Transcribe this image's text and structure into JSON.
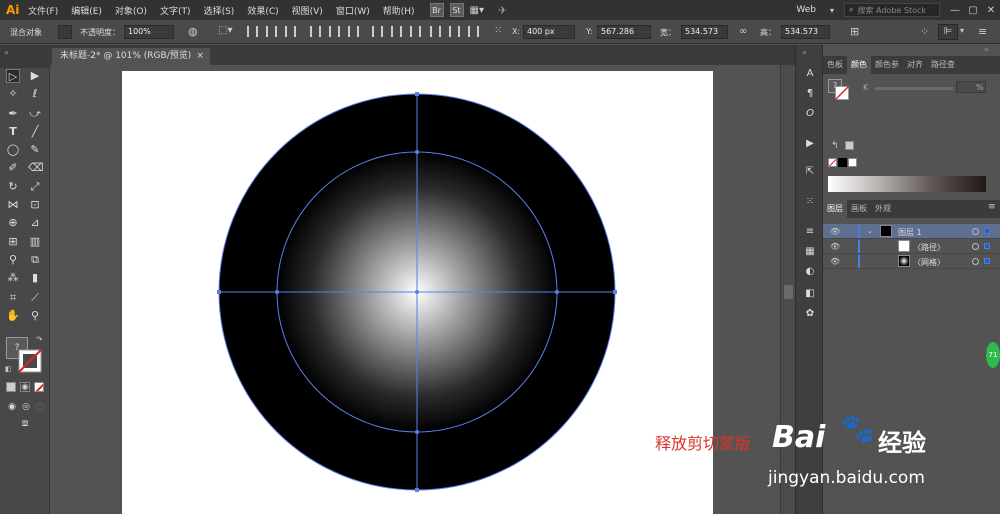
{
  "app": {
    "logo": "Ai"
  },
  "menu": {
    "items": [
      "文件(F)",
      "编辑(E)",
      "对象(O)",
      "文字(T)",
      "选择(S)",
      "效果(C)",
      "视图(V)",
      "窗口(W)",
      "帮助(H)"
    ],
    "bridge_btn": "Br",
    "stock_btn": "St",
    "workspace": "Web",
    "search_placeholder": "搜索 Adobe Stock",
    "win_minimize": "—",
    "win_restore": "▢",
    "win_close": "✕"
  },
  "control": {
    "object_type": "混合对象",
    "opacity_label": "不透明度：",
    "opacity_value": "100%",
    "x_label": "X:",
    "x_value": "400 px",
    "y_label": "Y:",
    "y_value": "567.286",
    "w_label": "宽：",
    "w_value": "534.573",
    "h_label": "高：",
    "h_value": "534.573"
  },
  "document": {
    "tab_label": "未标题-2* @ 101% (RGB/预览)",
    "close_label": "×"
  },
  "panels": {
    "color_tabs": [
      "色板",
      "颜色",
      "颜色参",
      "对齐",
      "路径查"
    ],
    "active_color_tab": "颜色",
    "k_label": "K",
    "k_percent": "%",
    "layer_tabs": [
      "图层",
      "画板",
      "外观"
    ],
    "active_layer_tab": "图层",
    "layers": [
      {
        "name": "图层 1",
        "level": 0
      },
      {
        "name": "〈路径〉",
        "level": 1
      },
      {
        "name": "〈网格〉",
        "level": 1
      }
    ]
  },
  "watermark": {
    "text_red": "释放剪切蒙版",
    "brand": "Bai",
    "brand2": "经验",
    "url": "jingyan.baidu.com",
    "badge": "71"
  },
  "colors": {
    "accent": "#4a7fe0",
    "selection_path": "#5b7fe8",
    "app_logo": "#ff9a00",
    "watermark_red": "#d9342b"
  }
}
